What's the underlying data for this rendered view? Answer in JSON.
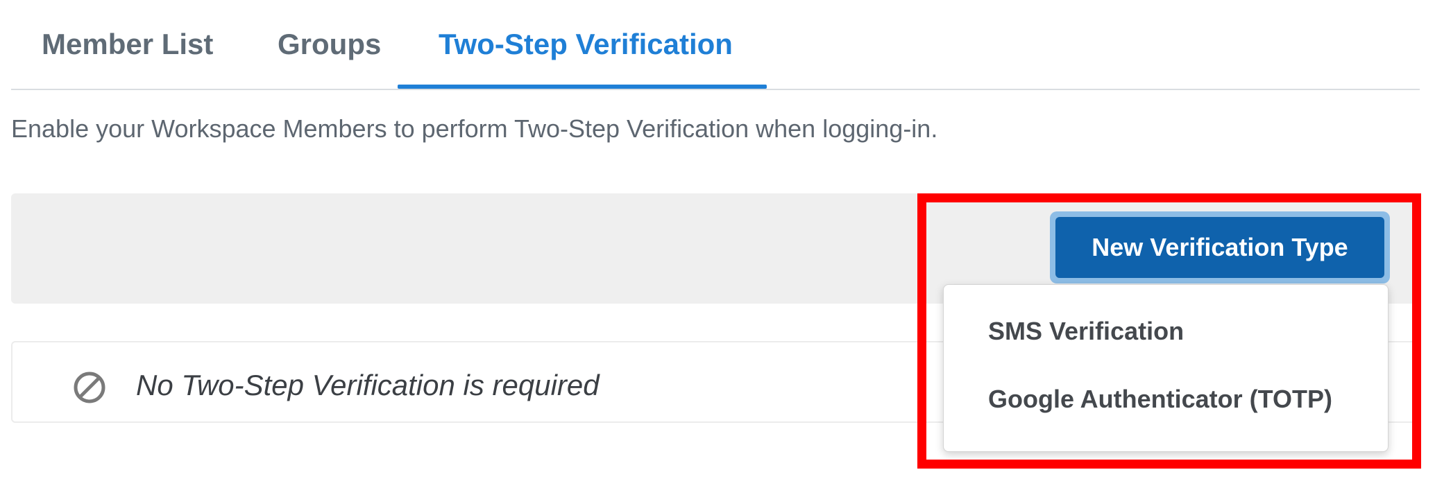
{
  "tabs": [
    {
      "label": "Member List",
      "active": false
    },
    {
      "label": "Groups",
      "active": false
    },
    {
      "label": "Two-Step Verification",
      "active": true
    }
  ],
  "description": "Enable your Workspace Members to perform Two-Step Verification when logging-in.",
  "action_bar": {
    "new_button_label": "New Verification Type"
  },
  "dropdown": {
    "items": [
      {
        "label": "SMS Verification"
      },
      {
        "label": "Google Authenticator (TOTP)"
      }
    ]
  },
  "status": {
    "icon": "ban-icon",
    "text": "No Two-Step Verification is required"
  },
  "colors": {
    "accent": "#1f7fd6",
    "primary_button": "#0f62ac",
    "highlight": "#ff0000",
    "tab_inactive": "#5f6b76"
  }
}
